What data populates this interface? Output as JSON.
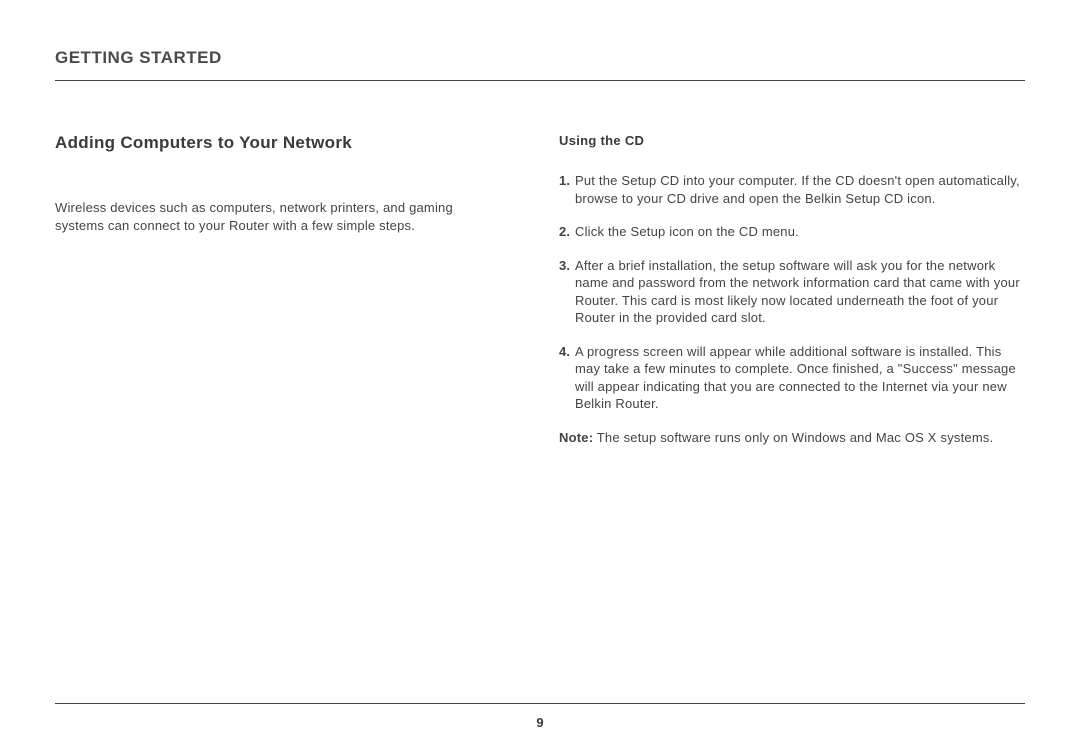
{
  "header": {
    "section": "GETTING STARTED"
  },
  "left": {
    "heading": "Adding Computers to Your Network",
    "intro": "Wireless devices such as computers, network printers, and gaming systems can connect to your Router with a few simple steps."
  },
  "right": {
    "heading": "Using the CD",
    "steps": [
      {
        "num": "1.",
        "text": "Put the Setup CD into your computer. If the CD doesn't open automatically, browse to your CD drive and open the Belkin Setup CD icon."
      },
      {
        "num": "2.",
        "text": "Click the Setup icon on the CD menu."
      },
      {
        "num": "3.",
        "text": "After a brief installation, the setup software will ask you for the network name and password from the network information card that came with your Router. This card is most likely now located underneath the foot of your Router in the provided card slot."
      },
      {
        "num": "4.",
        "text": "A progress screen will appear while additional software is installed. This may take a few minutes to complete. Once finished, a \"Success\" message will appear indicating that you are connected to the Internet via your new Belkin Router."
      }
    ],
    "note_label": "Note:",
    "note_text": " The setup software runs only on Windows and Mac OS X systems."
  },
  "footer": {
    "page_number": "9"
  }
}
